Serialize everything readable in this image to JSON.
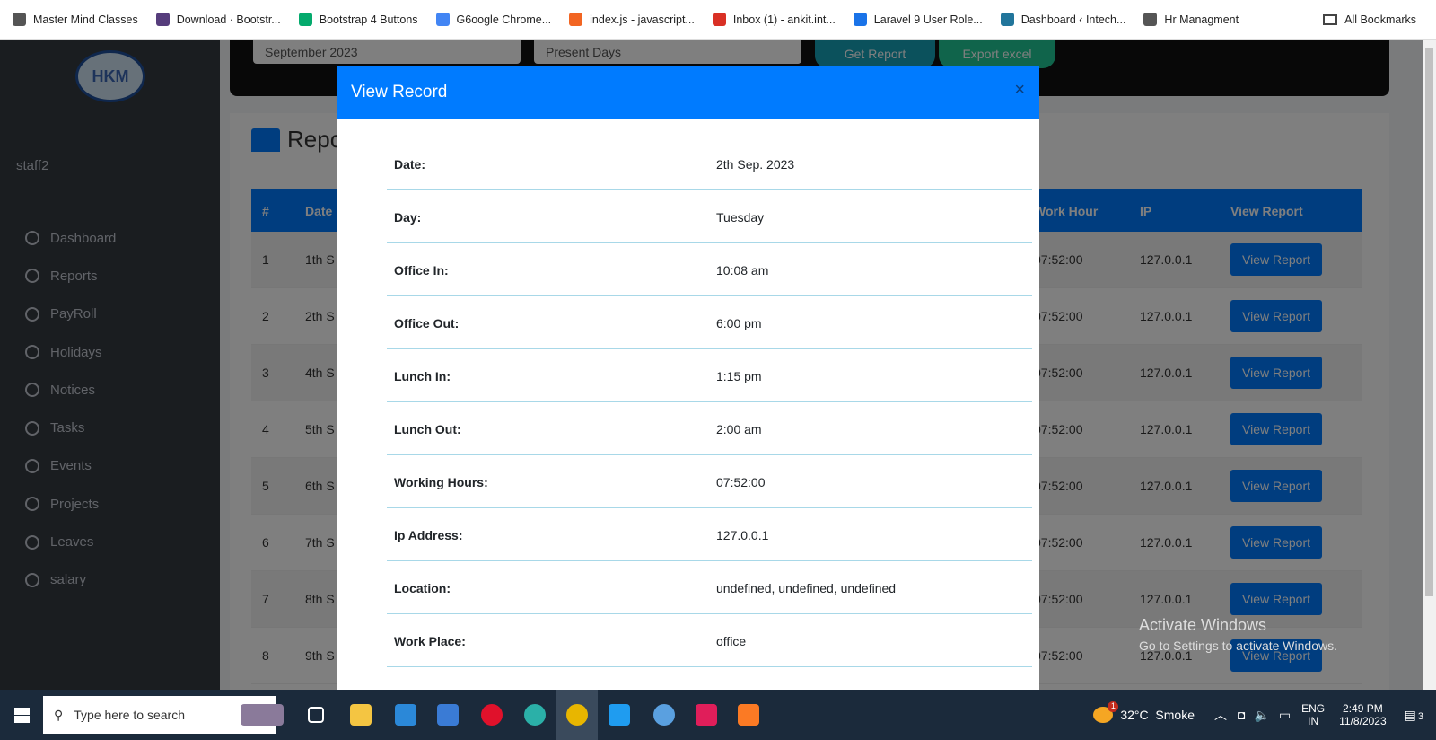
{
  "bookmarks": [
    {
      "label": "Master Mind Classes",
      "icon": "globe-icon",
      "color": "#555"
    },
    {
      "label": "Download · Bootstr...",
      "icon": "bootstrap-icon",
      "color": "#563d7c"
    },
    {
      "label": "Bootstrap 4 Buttons",
      "icon": "w3schools-icon",
      "color": "#04aa6d"
    },
    {
      "label": "G6oogle Chrome...",
      "icon": "google-icon",
      "color": "#4285f4"
    },
    {
      "label": "index.js - javascript...",
      "icon": "codesandbox-icon",
      "color": "#f26522"
    },
    {
      "label": "Inbox (1) - ankit.int...",
      "icon": "gmail-icon",
      "color": "#d93025"
    },
    {
      "label": "Laravel 9 User Role...",
      "icon": "braces-icon",
      "color": "#1a73e8"
    },
    {
      "label": "Dashboard ‹ Intech...",
      "icon": "wordpress-icon",
      "color": "#21759b"
    },
    {
      "label": "Hr Managment",
      "icon": "globe-icon",
      "color": "#555"
    }
  ],
  "all_bookmarks": "All Bookmarks",
  "sidebar": {
    "logo": "HKM",
    "user": "staff2",
    "items": [
      "Dashboard",
      "Reports",
      "PayRoll",
      "Holidays",
      "Notices",
      "Tasks",
      "Events",
      "Projects",
      "Leaves",
      "salary"
    ]
  },
  "filters": {
    "month": "September 2023",
    "type": "Present Days",
    "get_report": "Get Report",
    "export": "Export excel"
  },
  "report": {
    "title": "Repo",
    "headers": {
      "num": "#",
      "date": "Date",
      "work_hour": "Work Hour",
      "ip": "IP",
      "view": "View Report"
    },
    "rows": [
      {
        "num": "1",
        "date": "1th S",
        "work": "07:52:00",
        "ip": "127.0.0.1",
        "btn": "View Report"
      },
      {
        "num": "2",
        "date": "2th S",
        "work": "07:52:00",
        "ip": "127.0.0.1",
        "btn": "View Report"
      },
      {
        "num": "3",
        "date": "4th S",
        "work": "07:52:00",
        "ip": "127.0.0.1",
        "btn": "View Report"
      },
      {
        "num": "4",
        "date": "5th S",
        "work": "07:52:00",
        "ip": "127.0.0.1",
        "btn": "View Report"
      },
      {
        "num": "5",
        "date": "6th S",
        "work": "07:52:00",
        "ip": "127.0.0.1",
        "btn": "View Report"
      },
      {
        "num": "6",
        "date": "7th S",
        "work": "07:52:00",
        "ip": "127.0.0.1",
        "btn": "View Report"
      },
      {
        "num": "7",
        "date": "8th S",
        "work": "07:52:00",
        "ip": "127.0.0.1",
        "btn": "View Report"
      },
      {
        "num": "8",
        "date": "9th S",
        "work": "07:52:00",
        "ip": "127.0.0.1",
        "btn": "View Report"
      }
    ]
  },
  "modal": {
    "title": "View Record",
    "close": "×",
    "fields": [
      {
        "label": "Date:",
        "value": "2th Sep. 2023"
      },
      {
        "label": "Day:",
        "value": "Tuesday"
      },
      {
        "label": "Office In:",
        "value": "10:08 am"
      },
      {
        "label": "Office Out:",
        "value": "6:00 pm"
      },
      {
        "label": "Lunch In:",
        "value": "1:15 pm"
      },
      {
        "label": "Lunch Out:",
        "value": "2:00 am"
      },
      {
        "label": "Working Hours:",
        "value": "07:52:00"
      },
      {
        "label": "Ip Address:",
        "value": "127.0.0.1"
      },
      {
        "label": "Location:",
        "value": "undefined, undefined, undefined"
      },
      {
        "label": "Work Place:",
        "value": "office"
      }
    ]
  },
  "watermark": {
    "title": "Activate Windows",
    "sub": "Go to Settings to activate Windows."
  },
  "taskbar": {
    "search": "Type here to search",
    "weather": "32°C  Smoke",
    "weather_badge": "1",
    "lang1": "ENG",
    "lang2": "IN",
    "time": "2:49 PM",
    "date": "11/8/2023",
    "notif": "3"
  },
  "colors": {
    "primary": "#007bff",
    "sidebar": "#343a40"
  }
}
